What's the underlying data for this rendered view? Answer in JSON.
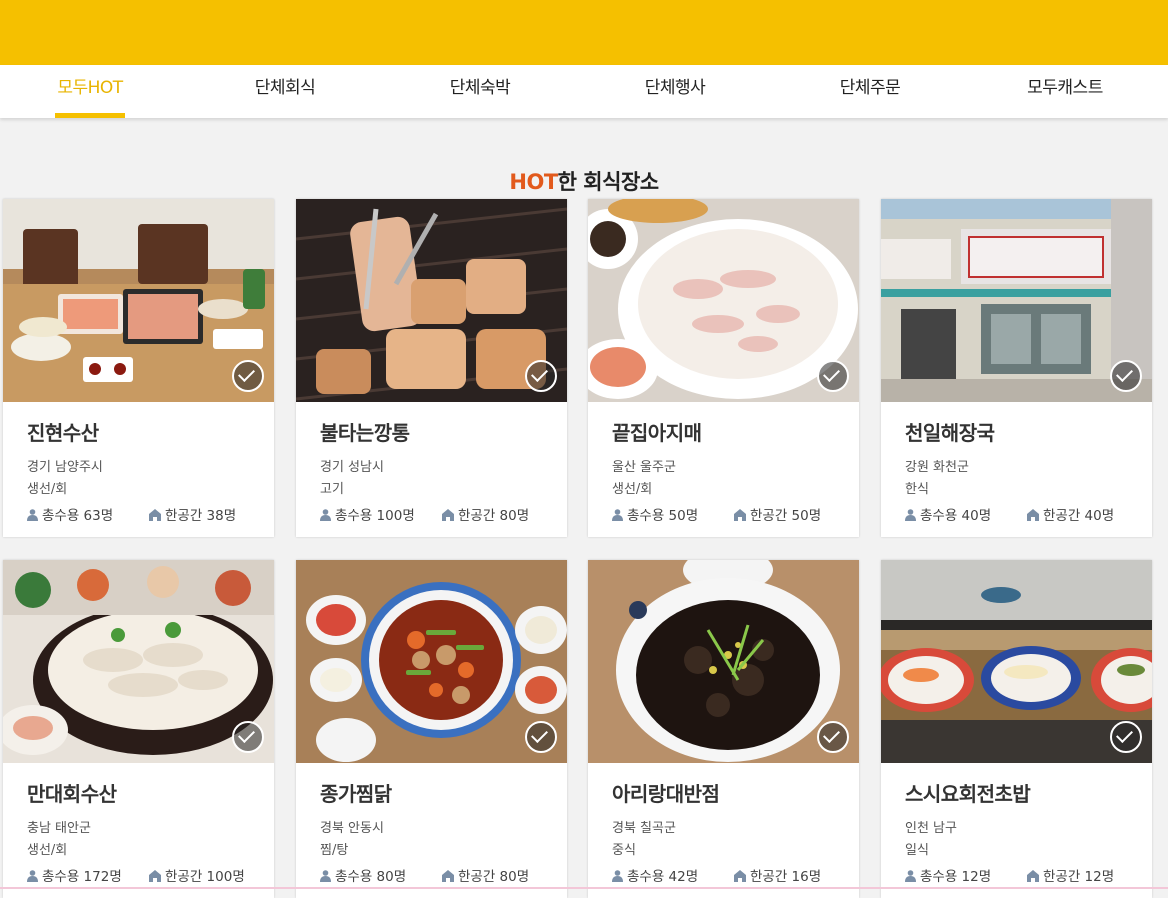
{
  "nav": {
    "tabs": [
      {
        "label": "모두HOT",
        "active": true
      },
      {
        "label": "단체회식"
      },
      {
        "label": "단체숙박"
      },
      {
        "label": "단체행사"
      },
      {
        "label": "단체주문"
      },
      {
        "label": "모두캐스트"
      }
    ]
  },
  "section": {
    "title_hot": "HOT",
    "title_rest": "한 회식장소"
  },
  "cards": [
    {
      "name": "진현수산",
      "region": "경기 남양주시",
      "category": "생선/회",
      "capacity": "총수용 63명",
      "room": "한공간 38명"
    },
    {
      "name": "불타는깡통",
      "region": "경기 성남시",
      "category": "고기",
      "capacity": "총수용 100명",
      "room": "한공간 80명"
    },
    {
      "name": "끝집아지매",
      "region": "울산 울주군",
      "category": "생선/회",
      "capacity": "총수용 50명",
      "room": "한공간 50명"
    },
    {
      "name": "천일해장국",
      "region": "강원 화천군",
      "category": "한식",
      "capacity": "총수용 40명",
      "room": "한공간 40명"
    },
    {
      "name": "만대회수산",
      "region": "충남 태안군",
      "category": "생선/회",
      "capacity": "총수용 172명",
      "room": "한공간 100명"
    },
    {
      "name": "종가찜닭",
      "region": "경북 안동시",
      "category": "찜/탕",
      "capacity": "총수용 80명",
      "room": "한공간 80명"
    },
    {
      "name": "아리랑대반점",
      "region": "경북 칠곡군",
      "category": "중식",
      "capacity": "총수용 42명",
      "room": "한공간 16명"
    },
    {
      "name": "스시요회전초밥",
      "region": "인천 남구",
      "category": "일식",
      "capacity": "총수용 12명",
      "room": "한공간 12명"
    }
  ],
  "colors": {
    "brand": "#f5c000",
    "hot": "#e25a1c"
  }
}
